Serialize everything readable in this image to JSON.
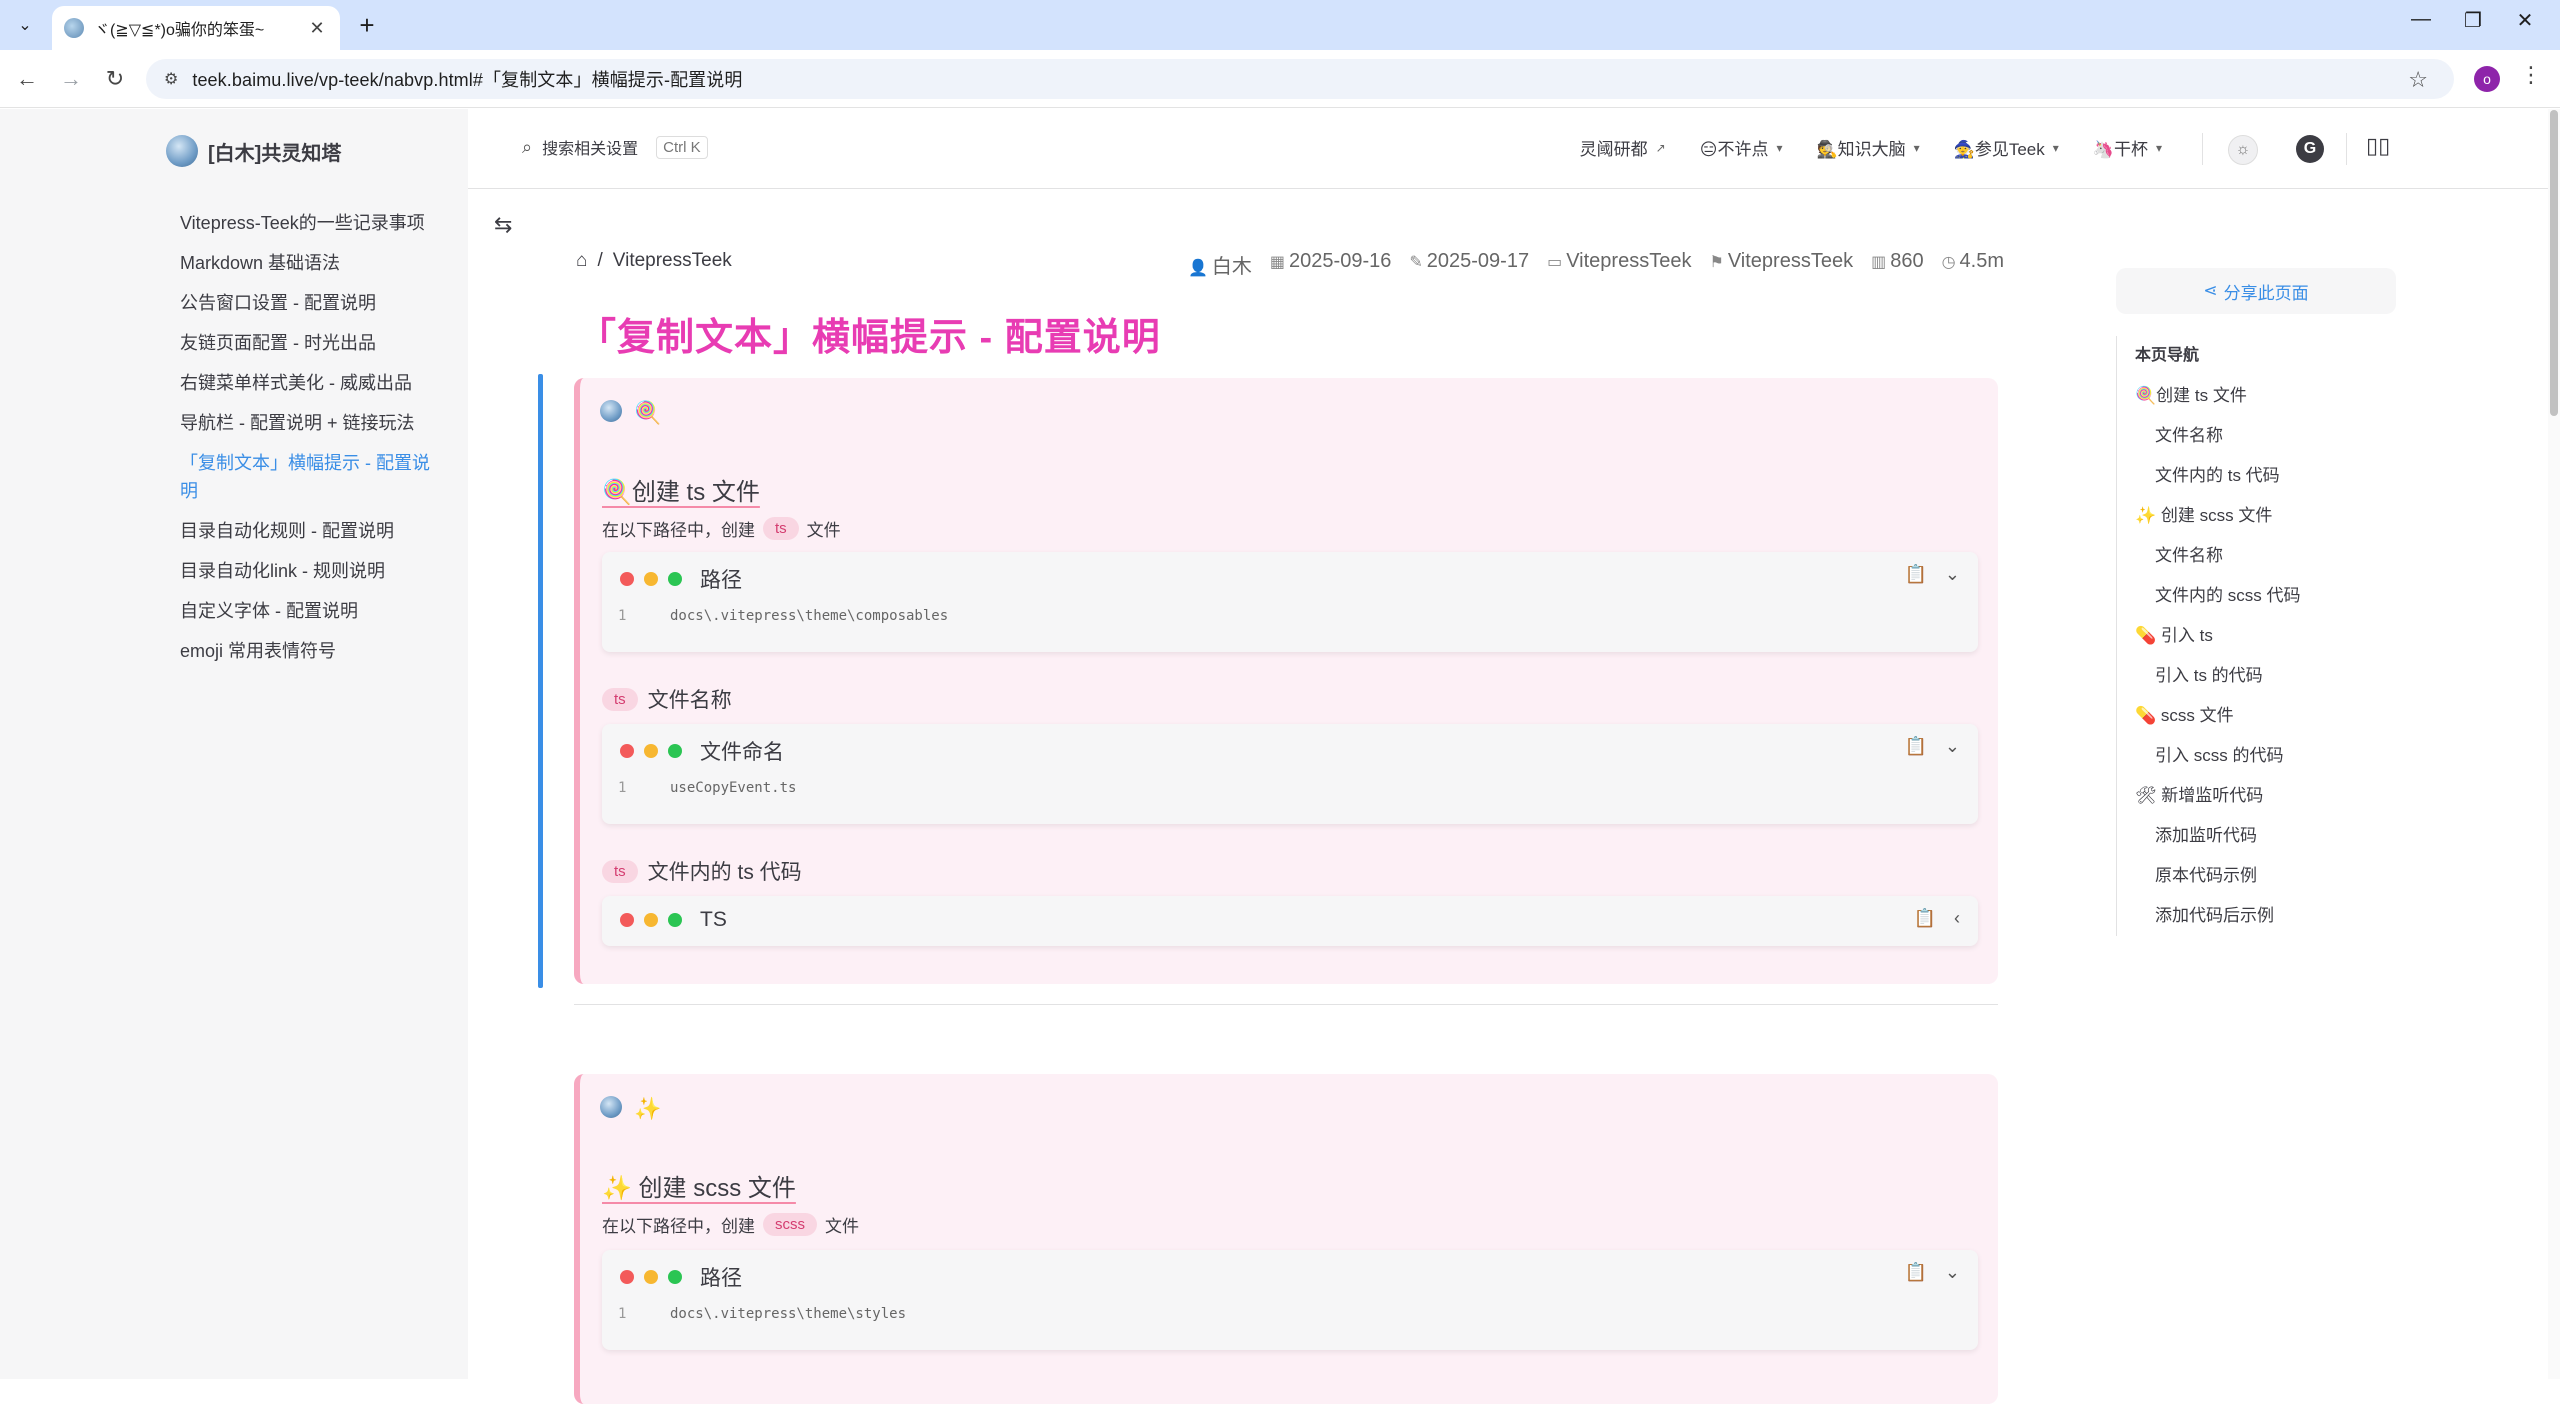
{
  "browser": {
    "tab_title": "ヾ(≧▽≦*)o骗你的笨蛋~",
    "url": "teek.baimu.live/vp-teek/nabvp.html#「复制文本」横幅提示-配置说明",
    "profile_initial": "o"
  },
  "site": {
    "title": "[白木]共灵知塔"
  },
  "sidebar": {
    "items": [
      {
        "label": "Vitepress-Teek的一些记录事项",
        "active": false
      },
      {
        "label": "Markdown 基础语法",
        "active": false
      },
      {
        "label": "公告窗口设置 - 配置说明",
        "active": false
      },
      {
        "label": "友链页面配置 - 时光出品",
        "active": false
      },
      {
        "label": "右键菜单样式美化 - 威威出品",
        "active": false
      },
      {
        "label": "导航栏 - 配置说明 + 链接玩法",
        "active": false
      },
      {
        "label": "「复制文本」横幅提示 - 配置说明",
        "active": true
      },
      {
        "label": "目录自动化规则 - 配置说明",
        "active": false
      },
      {
        "label": "目录自动化link - 规则说明",
        "active": false
      },
      {
        "label": "自定义字体 - 配置说明",
        "active": false
      },
      {
        "label": "emoji 常用表情符号",
        "active": false
      }
    ]
  },
  "topnav": {
    "search_placeholder": "搜索相关设置",
    "search_kbd": "Ctrl K",
    "links": [
      {
        "label": "灵阈研都",
        "suffix": "↗"
      },
      {
        "label": "😑不许点",
        "suffix": "▾"
      },
      {
        "label": "🕵知识大脑",
        "suffix": "▾"
      },
      {
        "label": "🧙参见Teek",
        "suffix": "▾"
      },
      {
        "label": "🦄干杯",
        "suffix": "▾"
      }
    ],
    "github_label": "G"
  },
  "breadcrumb": {
    "home_icon": "home-icon",
    "separator": "/",
    "current": "VitepressTeek"
  },
  "meta": {
    "author": "白木",
    "created": "2025-09-16",
    "updated": "2025-09-17",
    "category": "VitepressTeek",
    "tag": "VitepressTeek",
    "words": "860",
    "read_time": "4.5m"
  },
  "page_title": "「复制文本」横幅提示 - 配置说明",
  "sections": {
    "s1": {
      "emoji": "🍭",
      "heading": "🍭创建 ts 文件",
      "intro_before": "在以下路径中，创建",
      "intro_pill": "ts",
      "intro_after": "文件",
      "code_path": {
        "title": "路径",
        "line_no": "1",
        "code": "docs\\.vitepress\\theme\\composables"
      },
      "h3_name": {
        "pill": "ts",
        "label": "文件名称"
      },
      "code_name": {
        "title": "文件命名",
        "line_no": "1",
        "code": "useCopyEvent.ts"
      },
      "h3_code": {
        "pill": "ts",
        "label": "文件内的 ts 代码"
      },
      "code_ts": {
        "title": "TS"
      }
    },
    "s2": {
      "emoji": "✨",
      "heading": "✨ 创建 scss 文件",
      "intro_before": "在以下路径中，创建",
      "intro_pill": "scss",
      "intro_after": "文件",
      "code_path": {
        "title": "路径",
        "line_no": "1",
        "code": "docs\\.vitepress\\theme\\styles"
      }
    }
  },
  "aside": {
    "share_label": "分享此页面",
    "toc_title": "本页导航",
    "toc": [
      {
        "label": "🍭创建 ts 文件",
        "level": 1
      },
      {
        "label": "文件名称",
        "level": 2
      },
      {
        "label": "文件内的 ts 代码",
        "level": 2
      },
      {
        "label": "✨ 创建 scss 文件",
        "level": 1
      },
      {
        "label": "文件名称",
        "level": 2
      },
      {
        "label": "文件内的 scss 代码",
        "level": 2
      },
      {
        "label": "💊 引入 ts",
        "level": 1
      },
      {
        "label": "引入 ts 的代码",
        "level": 2
      },
      {
        "label": "💊 scss 文件",
        "level": 1
      },
      {
        "label": "引入 scss 的代码",
        "level": 2
      },
      {
        "label": "🛠 新增监听代码",
        "level": 1
      },
      {
        "label": "添加监听代码",
        "level": 2
      },
      {
        "label": "原本代码示例",
        "level": 2
      },
      {
        "label": "添加代码后示例",
        "level": 2
      }
    ]
  }
}
